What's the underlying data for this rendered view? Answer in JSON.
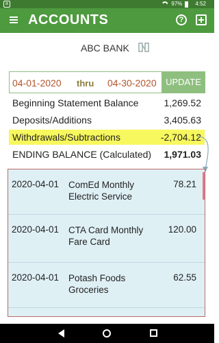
{
  "status_bar": {
    "app_badge": "a",
    "battery": "97%",
    "time": "4:52"
  },
  "app_bar": {
    "title": "ACCOUNTS",
    "color": "#4e9a3f"
  },
  "bank": {
    "name": "ABC BANK"
  },
  "date_range": {
    "from": "04-01-2020",
    "thru_label": "thru",
    "to": "04-30-2020",
    "update_label": "UPDATE"
  },
  "summary": {
    "beginning": {
      "label": "Beginning Statement Balance",
      "value": "1,269.52"
    },
    "deposits": {
      "label": "Deposits/Additions",
      "value": "3,405.63"
    },
    "withdrawals": {
      "label": "Withdrawals/Subtractions",
      "value": "-2,704.12"
    },
    "ending": {
      "label": "ENDING BALANCE (Calculated)",
      "value": "1,971.03"
    }
  },
  "transactions": [
    {
      "date": "2020-04-01",
      "description": "ComEd Monthly Electric Service",
      "amount": "78.21"
    },
    {
      "date": "2020-04-01",
      "description": "CTA Card Monthly Fare Card",
      "amount": "120.00"
    },
    {
      "date": "2020-04-01",
      "description": "Potash Foods Groceries",
      "amount": "62.55"
    }
  ],
  "colors": {
    "highlight": "#f7f75e",
    "date_text": "#b4532a",
    "panel_bg": "#dff0f5"
  },
  "icons": [
    "menu-icon",
    "help-icon",
    "add-icon",
    "link-icon",
    "back-icon",
    "home-icon",
    "recent-apps-icon"
  ]
}
